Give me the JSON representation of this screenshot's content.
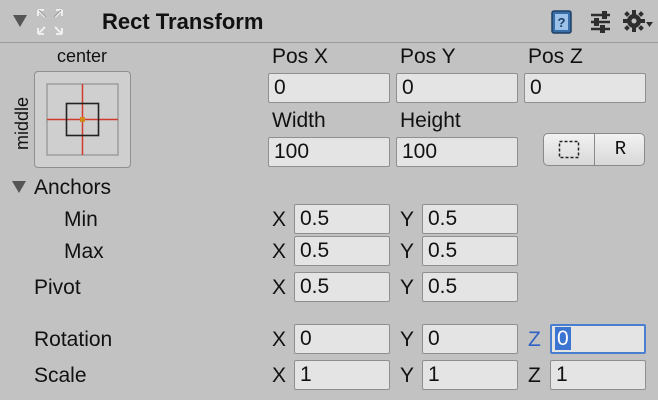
{
  "header": {
    "title": "Rect Transform",
    "icons": [
      "component-icon",
      "help-book-icon",
      "presets-icon",
      "settings-gear-icon"
    ]
  },
  "anchor_preset": {
    "horizontal": "center",
    "vertical": "middle"
  },
  "labels": {
    "pos_x": "Pos X",
    "pos_y": "Pos Y",
    "pos_z": "Pos Z",
    "width": "Width",
    "height": "Height",
    "anchors": "Anchors",
    "min": "Min",
    "max": "Max",
    "pivot": "Pivot",
    "rotation": "Rotation",
    "scale": "Scale",
    "x": "X",
    "y": "Y",
    "z": "Z"
  },
  "values": {
    "pos_x": "0",
    "pos_y": "0",
    "pos_z": "0",
    "width": "100",
    "height": "100",
    "anchor_min_x": "0.5",
    "anchor_min_y": "0.5",
    "anchor_max_x": "0.5",
    "anchor_max_y": "0.5",
    "pivot_x": "0.5",
    "pivot_y": "0.5",
    "rotation_x": "0",
    "rotation_y": "0",
    "rotation_z": "0",
    "scale_x": "1",
    "scale_y": "1",
    "scale_z": "1"
  },
  "buttons": {
    "raw_edit": "R"
  },
  "colors": {
    "panel_bg": "#c2c2c2",
    "field_bg": "#e4e4e4",
    "focus_accent": "#4a7fd0",
    "anchor_red": "#d03a2e",
    "anchor_center": "#d08a1e"
  }
}
